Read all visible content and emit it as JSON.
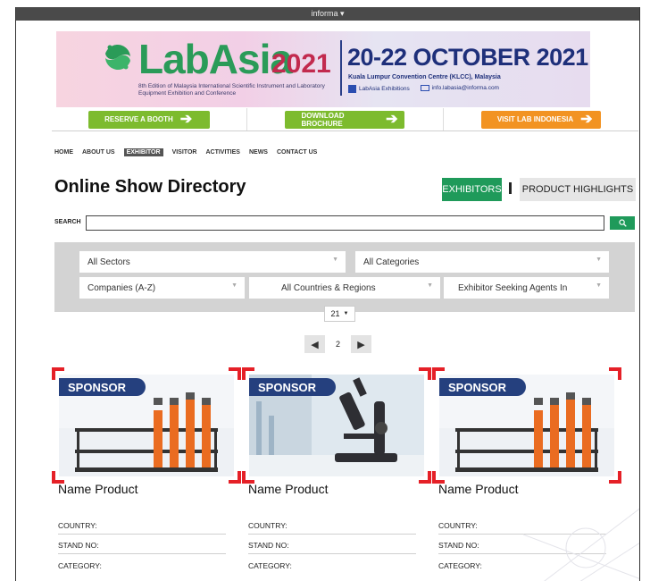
{
  "topbar": {
    "brand": "informa ▾"
  },
  "banner": {
    "logo_text": "LabAsia",
    "logo_year": "2021",
    "subtitle": "8th Edition of Malaysia International Scientific Instrument and Laboratory Equipment Exhibition and Conference",
    "dates": "20-22 OCTOBER 2021",
    "venue": "Kuala Lumpur Convention Centre (KLCC), Malaysia",
    "facebook": "LabAsia Exhibitions",
    "email": "info.labasia@informa.com"
  },
  "cta": {
    "reserve": "RESERVE A BOOTH",
    "download": "DOWNLOAD BROCHURE",
    "visit": "VISIT LAB INDONESIA",
    "colors": {
      "green": "#7dbb2e",
      "orange": "#f29322"
    }
  },
  "nav": {
    "items": [
      "HOME",
      "ABOUT US",
      "EXHIBITOR",
      "VISITOR",
      "ACTIVITIES",
      "NEWS",
      "CONTACT US"
    ],
    "active": "EXHIBITOR"
  },
  "page": {
    "title": "Online Show Directory",
    "tab_exhibitors": "EXHIBITORS",
    "tab_products": "PRODUCT HIGHLIGHTS"
  },
  "search": {
    "label": "SEARCH",
    "value": "",
    "button_icon": "search-icon"
  },
  "filters": {
    "sectors": "All Sectors",
    "categories": "All Categories",
    "sort": "Companies (A-Z)",
    "countries": "All Countries & Regions",
    "agents": "Exhibitor Seeking Agents In"
  },
  "pagination": {
    "per_page": "21",
    "current_page": "2"
  },
  "cards": [
    {
      "badge": "SPONSOR",
      "name": "Name Product",
      "country": "COUNTRY:",
      "stand": "STAND NO:",
      "category": "CATEGORY:",
      "image": "test-tubes"
    },
    {
      "badge": "SPONSOR",
      "name": "Name Product",
      "country": "COUNTRY:",
      "stand": "STAND NO:",
      "category": "CATEGORY:",
      "image": "microscope"
    },
    {
      "badge": "SPONSOR",
      "name": "Name Product",
      "country": "COUNTRY:",
      "stand": "STAND NO:",
      "category": "CATEGORY:",
      "image": "test-tubes"
    }
  ],
  "colors": {
    "accent_green": "#1f9a5a",
    "bracket_red": "#e52027",
    "sponsor_blue": "#25407e"
  }
}
